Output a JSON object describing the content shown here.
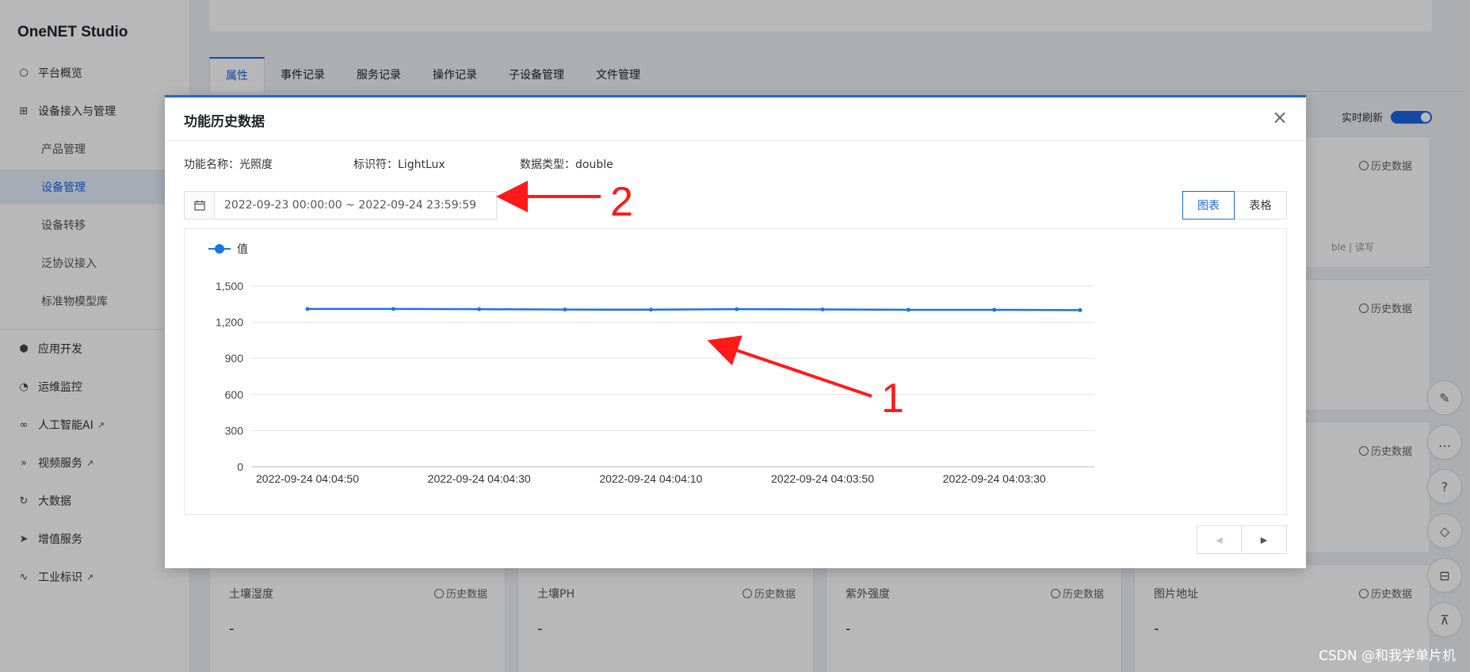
{
  "app": {
    "brand": "OneNET Studio"
  },
  "sidebar": {
    "items": [
      {
        "label": "平台概览",
        "icon": "hexagon-icon"
      },
      {
        "label": "设备接入与管理",
        "icon": "device-tree-icon"
      },
      {
        "label": "产品管理"
      },
      {
        "label": "设备管理",
        "active": true
      },
      {
        "label": "设备转移"
      },
      {
        "label": "泛协议接入"
      },
      {
        "label": "标准物模型库"
      },
      {
        "label": "应用开发",
        "icon": "cube-icon"
      },
      {
        "label": "运维监控",
        "icon": "pie-icon"
      },
      {
        "label": "人工智能AI",
        "icon": "link-icon",
        "external": true
      },
      {
        "label": "视频服务",
        "icon": "play-forward-icon",
        "external": true
      },
      {
        "label": "大数据",
        "icon": "refresh-icon"
      },
      {
        "label": "增值服务",
        "icon": "send-icon"
      },
      {
        "label": "工业标识",
        "icon": "wave-icon",
        "external": true
      }
    ]
  },
  "tabs": [
    {
      "label": "属性",
      "active": true
    },
    {
      "label": "事件记录"
    },
    {
      "label": "服务记录"
    },
    {
      "label": "操作记录"
    },
    {
      "label": "子设备管理"
    },
    {
      "label": "文件管理"
    }
  ],
  "realtime_label": "实时刷新",
  "history_label": "历史数据",
  "cards_bottom": [
    {
      "title": "土壤湿度",
      "value": "-"
    },
    {
      "title": "土壤PH",
      "value": "-"
    },
    {
      "title": "紫外强度",
      "value": "-"
    },
    {
      "title": "图片地址",
      "value": "-"
    }
  ],
  "card_right_top_foot": "ble | 读写",
  "modal": {
    "title": "功能历史数据",
    "meta": {
      "name_label": "功能名称：",
      "name_value": "光照度",
      "id_label": "标识符：",
      "id_value": "LightLux",
      "type_label": "数据类型：",
      "type_value": "double"
    },
    "range_text": "2022-09-23 00:00:00 ~ 2022-09-24 23:59:59",
    "view_chart": "图表",
    "view_table": "表格"
  },
  "chart_data": {
    "type": "line",
    "legend": [
      "值"
    ],
    "x": [
      "2022-09-24 04:04:50",
      "2022-09-24 04:04:40",
      "2022-09-24 04:04:30",
      "2022-09-24 04:04:20",
      "2022-09-24 04:04:10",
      "2022-09-24 04:04:00",
      "2022-09-24 04:03:50",
      "2022-09-24 04:03:40",
      "2022-09-24 04:03:30",
      "2022-09-24 04:03:20"
    ],
    "x_tick_labels": [
      "2022-09-24 04:04:50",
      "2022-09-24 04:04:30",
      "2022-09-24 04:04:10",
      "2022-09-24 04:03:50",
      "2022-09-24 04:03:30"
    ],
    "series": [
      {
        "name": "值",
        "values": [
          1310,
          1310,
          1308,
          1305,
          1304,
          1308,
          1306,
          1303,
          1303,
          1300
        ]
      }
    ],
    "y_ticks": [
      "0",
      "300",
      "600",
      "900",
      "1,200",
      "1,500"
    ],
    "ylim": [
      0,
      1500
    ],
    "grid": true,
    "legend_position": "top-left",
    "color": "#1a73e8"
  },
  "annotations": {
    "label1": "1",
    "label2": "2",
    "color": "#ff1a1a"
  },
  "watermark": "CSDN @和我学单片机"
}
